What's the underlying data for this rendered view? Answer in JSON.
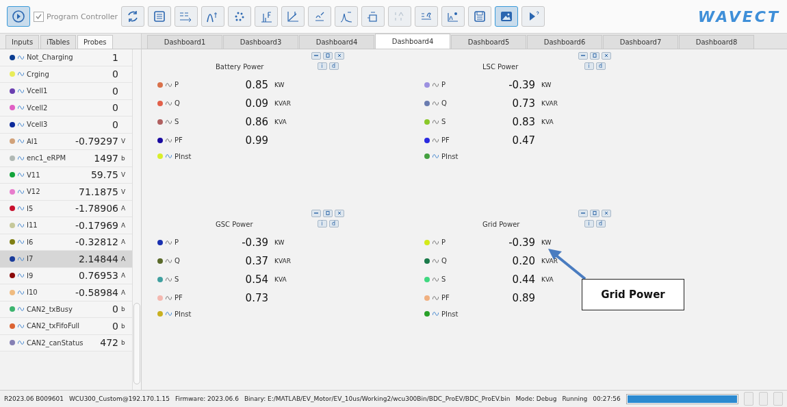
{
  "toolbar": {
    "program_controller": {
      "label": "Program Controller",
      "checked": true,
      "disabled": true
    },
    "logo": "WAVECT"
  },
  "side_tabs": [
    {
      "label": "Inputs",
      "selected": false
    },
    {
      "label": "iTables",
      "selected": false
    },
    {
      "label": "Probes",
      "selected": true
    }
  ],
  "probes": [
    {
      "name": "Not_Charging",
      "value": "1",
      "color": "#0b3d91",
      "selected": false
    },
    {
      "name": "Crging",
      "value": "0",
      "color": "#e8ec5a",
      "selected": false
    },
    {
      "name": "Vcell1",
      "value": "0",
      "color": "#6a3fb0",
      "selected": false
    },
    {
      "name": "Vcell2",
      "value": "0",
      "color": "#e05fc4",
      "selected": false
    },
    {
      "name": "Vcell3",
      "value": "0",
      "color": "#0c2a9a",
      "selected": false
    },
    {
      "name": "AI1",
      "value": "-0.79297",
      "unit": "V",
      "color": "#d1a27a",
      "selected": false
    },
    {
      "name": "enc1_eRPM",
      "value": "1497",
      "unit": "b",
      "color": "#b0b8b4",
      "selected": false
    },
    {
      "name": "V11",
      "value": "59.75",
      "unit": "V",
      "color": "#12a33a",
      "selected": false
    },
    {
      "name": "V12",
      "value": "71.1875",
      "unit": "V",
      "color": "#e77ccc",
      "selected": false
    },
    {
      "name": "I5",
      "value": "-1.78906",
      "unit": "A",
      "color": "#c8102e",
      "selected": false
    },
    {
      "name": "I11",
      "value": "-0.17969",
      "unit": "A",
      "color": "#c6c89a",
      "selected": false
    },
    {
      "name": "I6",
      "value": "-0.32812",
      "unit": "A",
      "color": "#7f7f14",
      "selected": false
    },
    {
      "name": "I7",
      "value": "2.14844",
      "unit": "A",
      "color": "#1a3c9a",
      "selected": true
    },
    {
      "name": "I9",
      "value": "0.76953",
      "unit": "A",
      "color": "#8b0a0a",
      "selected": false
    },
    {
      "name": "I10",
      "value": "-0.58984",
      "unit": "A",
      "color": "#efbb80",
      "selected": false
    },
    {
      "name": "CAN2_txBusy",
      "value": "0",
      "unit": "b",
      "color": "#3cb46e",
      "selected": false
    },
    {
      "name": "CAN2_txFifoFull",
      "value": "0",
      "unit": "b",
      "color": "#dc6433",
      "selected": false
    },
    {
      "name": "CAN2_canStatus",
      "value": "472",
      "unit": "b",
      "color": "#8580b4",
      "selected": false
    }
  ],
  "dashboard_tabs": [
    {
      "label": "Dashboard1",
      "selected": false
    },
    {
      "label": "Dashboard3",
      "selected": false
    },
    {
      "label": "Dashboard4",
      "selected": false
    },
    {
      "label": "Dashboard4",
      "selected": true
    },
    {
      "label": "Dashboard5",
      "selected": false
    },
    {
      "label": "Dashboard6",
      "selected": false
    },
    {
      "label": "Dashboard7",
      "selected": false
    },
    {
      "label": "Dashboard8",
      "selected": false
    }
  ],
  "panels": [
    {
      "title": "Battery Power",
      "info_buttons": [
        "i",
        "d"
      ],
      "signals": [
        {
          "name": "P",
          "value": "0.85",
          "unit": "KW",
          "color": "#d9714a"
        },
        {
          "name": "Q",
          "value": "0.09",
          "unit": "KVAR",
          "color": "#e2604a"
        },
        {
          "name": "S",
          "value": "0.86",
          "unit": "KVA",
          "color": "#b06060"
        },
        {
          "name": "PF",
          "value": "0.99",
          "color": "#1a0aa0"
        },
        {
          "name": "PInst",
          "color": "#d8ee2a"
        }
      ]
    },
    {
      "title": "LSC Power",
      "info_buttons": [
        "i",
        "d"
      ],
      "signals": [
        {
          "name": "P",
          "value": "-0.39",
          "unit": "KW",
          "color": "#9c90e0"
        },
        {
          "name": "Q",
          "value": "0.73",
          "unit": "KVAR",
          "color": "#6a7cb0"
        },
        {
          "name": "S",
          "value": "0.83",
          "unit": "KVA",
          "color": "#8ac82a"
        },
        {
          "name": "PF",
          "value": "0.47",
          "color": "#2a2ae0"
        },
        {
          "name": "PInst",
          "color": "#44a040"
        }
      ]
    },
    {
      "title": "GSC Power",
      "info_buttons": [
        "i",
        "d"
      ],
      "signals": [
        {
          "name": "P",
          "value": "-0.39",
          "unit": "KW",
          "color": "#1a30b0"
        },
        {
          "name": "Q",
          "value": "0.37",
          "unit": "KVAR",
          "color": "#5a6a2a"
        },
        {
          "name": "S",
          "value": "0.54",
          "unit": "KVA",
          "color": "#40a0a0"
        },
        {
          "name": "PF",
          "value": "0.73",
          "color": "#f4b8b0"
        },
        {
          "name": "PInst",
          "color": "#c8b020"
        }
      ]
    },
    {
      "title": "Grid Power",
      "info_buttons": [
        "i",
        "d"
      ],
      "signals": [
        {
          "name": "P",
          "value": "-0.39",
          "unit": "KW",
          "color": "#d4ea1a"
        },
        {
          "name": "Q",
          "value": "0.20",
          "unit": "KVAR",
          "color": "#1a7a4a"
        },
        {
          "name": "S",
          "value": "0.44",
          "unit": "KVA",
          "color": "#40d880"
        },
        {
          "name": "PF",
          "value": "0.89",
          "color": "#f0b080"
        },
        {
          "name": "PInst",
          "color": "#28a028"
        }
      ]
    }
  ],
  "callout": {
    "text": "Grid Power"
  },
  "status_bar": {
    "version": "R2023.06 B009601",
    "target": "WCU300_Custom@192.170.1.15",
    "firmware": "Firmware: 2023.06.6",
    "binary": "Binary: E:/MATLAB/EV_Motor/EV_10us/Working2/wcu300Bin/BDC_ProEV/BDC_ProEV.bin",
    "mode": "Mode: Debug",
    "state": "Running",
    "time": "00:27:56",
    "level": 1.0
  }
}
